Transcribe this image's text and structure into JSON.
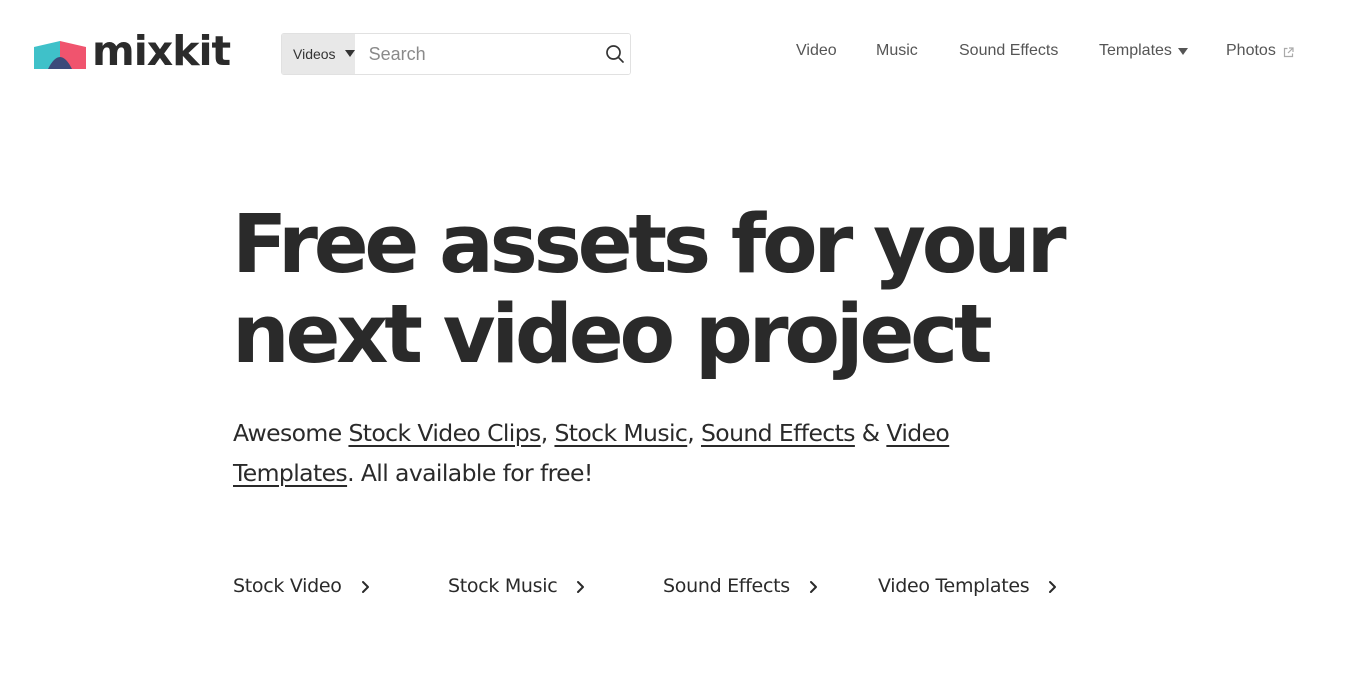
{
  "brand": {
    "name": "mixkit",
    "logo_icon": "mixkit-logo-icon"
  },
  "search": {
    "scope_label": "Videos",
    "placeholder": "Search",
    "value": ""
  },
  "nav": {
    "items": [
      {
        "label": "Video"
      },
      {
        "label": "Music"
      },
      {
        "label": "Sound Effects"
      },
      {
        "label": "Templates",
        "icon": "caret-down-icon"
      },
      {
        "label": "Photos",
        "icon": "external-link-icon"
      }
    ]
  },
  "hero": {
    "title_line1": "Free assets for your",
    "title_line2": "next video project",
    "sub": {
      "prefix": "Awesome ",
      "link1": "Stock Video Clips",
      "sep1": ", ",
      "link2": "Stock Music",
      "sep2": ", ",
      "link3": "Sound Effects",
      "sep3": " & ",
      "link4": "Video Templates",
      "suffix": ". All available for free!"
    }
  },
  "categories": [
    {
      "label": "Stock Video",
      "icon": "chevron-right-icon"
    },
    {
      "label": "Stock Music",
      "icon": "chevron-right-icon"
    },
    {
      "label": "Sound Effects",
      "icon": "chevron-right-icon"
    },
    {
      "label": "Video Templates",
      "icon": "chevron-right-icon"
    }
  ],
  "colors": {
    "text": "#2a2a2a",
    "nav_text": "#555555",
    "logo_teal": "#3fc1c9",
    "logo_pink": "#f0546e",
    "logo_navy": "#3c4a7a",
    "scope_bg": "#e8e8e8"
  }
}
